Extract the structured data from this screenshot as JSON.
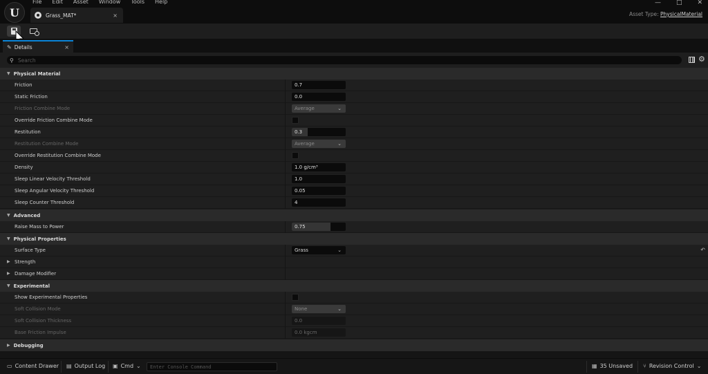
{
  "menu": {
    "items": [
      "File",
      "Edit",
      "Asset",
      "Window",
      "Tools",
      "Help"
    ],
    "window_controls": [
      "—",
      "□",
      "✕"
    ]
  },
  "document_tab": {
    "label": "Grass_MAT*",
    "close": "×"
  },
  "asset_type": {
    "label": "Asset Type:",
    "value": "PhysicalMaterial"
  },
  "details_tab": {
    "label": "Details",
    "close": "×"
  },
  "search": {
    "placeholder": "Search"
  },
  "categories": {
    "physical_material": "Physical Material",
    "advanced": "Advanced",
    "physical_properties": "Physical Properties",
    "experimental": "Experimental",
    "debugging": "Debugging"
  },
  "props": {
    "friction": {
      "label": "Friction",
      "value": "0.7"
    },
    "static_friction": {
      "label": "Static Friction",
      "value": "0.0"
    },
    "friction_combine_mode": {
      "label": "Friction Combine Mode",
      "value": "Average"
    },
    "override_friction_combine_mode": {
      "label": "Override Friction Combine Mode",
      "checked": false
    },
    "restitution": {
      "label": "Restitution",
      "value": "0.3",
      "fill": 0.3
    },
    "restitution_combine_mode": {
      "label": "Restitution Combine Mode",
      "value": "Average"
    },
    "override_restitution_combine_mode": {
      "label": "Override Restitution Combine Mode",
      "checked": false
    },
    "density": {
      "label": "Density",
      "value": "1.0 g/cm³"
    },
    "sleep_linear": {
      "label": "Sleep Linear Velocity Threshold",
      "value": "1.0"
    },
    "sleep_angular": {
      "label": "Sleep Angular Velocity Threshold",
      "value": "0.05"
    },
    "sleep_counter": {
      "label": "Sleep Counter Threshold",
      "value": "4"
    },
    "raise_mass": {
      "label": "Raise Mass to Power",
      "value": "0.75",
      "fill": 0.72
    },
    "surface_type": {
      "label": "Surface Type",
      "value": "Grass"
    },
    "strength": {
      "label": "Strength"
    },
    "damage_modifier": {
      "label": "Damage Modifier"
    },
    "show_experimental": {
      "label": "Show Experimental Properties",
      "checked": false
    },
    "soft_collision_mode": {
      "label": "Soft Collision Mode",
      "value": "None"
    },
    "soft_collision_thickness": {
      "label": "Soft Collision Thickness",
      "value": "0.0"
    },
    "base_friction_impulse": {
      "label": "Base Friction Impulse",
      "value": "0.0 kgcm"
    }
  },
  "statusbar": {
    "content_drawer": "Content Drawer",
    "output_log": "Output Log",
    "cmd": "Cmd",
    "console_placeholder": "Enter Console Command",
    "unsaved": "35 Unsaved",
    "revision_control": "Revision Control"
  },
  "colors": {
    "accent": "#0a84d8",
    "background": "#1b1b1b",
    "category": "#2a2a2a"
  }
}
